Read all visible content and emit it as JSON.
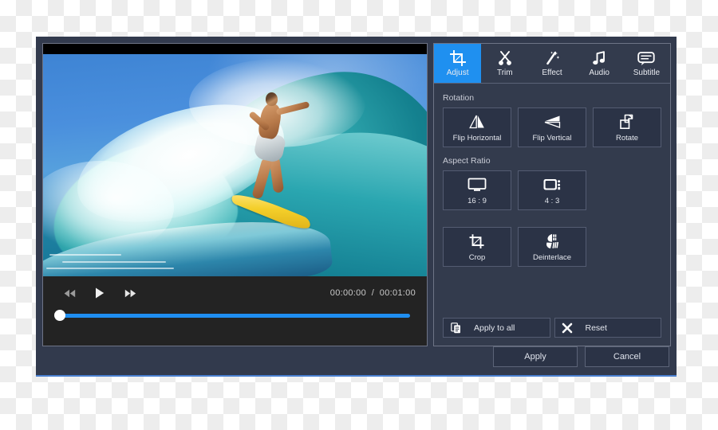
{
  "window": {
    "accent_color": "#1f90f0",
    "panel_bg": "#333b4d",
    "button_bg": "#2b3346"
  },
  "player": {
    "rewind_label": "Rewind",
    "play_label": "Play",
    "forward_label": "Fast Forward",
    "current_time": "00:00:00",
    "separator": "/",
    "total_time": "00:01:00",
    "time_display": "00:00:00  /  00:01:00",
    "progress_percent": 0,
    "video_description": "Surfer riding a large turquoise ocean wave on a yellow surfboard"
  },
  "tabs": [
    {
      "label": "Adjust",
      "icon": "crop-icon",
      "active": true
    },
    {
      "label": "Trim",
      "icon": "scissors-icon",
      "active": false
    },
    {
      "label": "Effect",
      "icon": "magic-wand-icon",
      "active": false
    },
    {
      "label": "Audio",
      "icon": "music-note-icon",
      "active": false
    },
    {
      "label": "Subtitle",
      "icon": "speech-bubble-icon",
      "active": false
    }
  ],
  "adjust_panel": {
    "rotation": {
      "label": "Rotation",
      "buttons": [
        {
          "label": "Flip Horizontal",
          "icon": "flip-horizontal-icon"
        },
        {
          "label": "Flip Vertical",
          "icon": "flip-vertical-icon"
        },
        {
          "label": "Rotate",
          "icon": "rotate-icon"
        }
      ]
    },
    "aspect_ratio": {
      "label": "Aspect Ratio",
      "buttons": [
        {
          "label": "16 : 9",
          "icon": "widescreen-monitor-icon"
        },
        {
          "label": "4 : 3",
          "icon": "crt-television-icon"
        }
      ]
    },
    "extras": {
      "buttons": [
        {
          "label": "Crop",
          "icon": "crop-icon"
        },
        {
          "label": "Deinterlace",
          "icon": "deinterlace-icon"
        }
      ]
    },
    "footer": {
      "apply_to_all_label": "Apply to all",
      "apply_to_all_icon": "copy-icon",
      "reset_label": "Reset",
      "reset_icon": "close-x-icon"
    }
  },
  "action_bar": {
    "apply_label": "Apply",
    "cancel_label": "Cancel"
  }
}
